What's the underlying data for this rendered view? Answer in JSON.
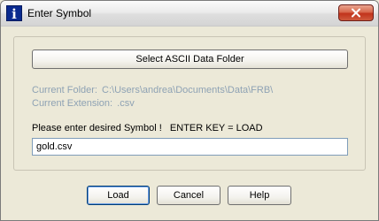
{
  "window": {
    "title": "Enter Symbol",
    "icon_glyph": "i",
    "icon_name": "info-icon"
  },
  "dialog": {
    "select_folder_label": "Select ASCII Data Folder",
    "current_folder_label": "Current Folder:",
    "current_folder_value": "C:\\Users\\andrea\\Documents\\Data\\FRB\\",
    "current_extension_label": "Current Extension:",
    "current_extension_value": ".csv",
    "prompt": "Please enter desired Symbol !   ENTER KEY = LOAD",
    "symbol_value": "gold.csv"
  },
  "buttons": {
    "load": "Load",
    "cancel": "Cancel",
    "help": "Help"
  },
  "colors": {
    "window_bg": "#ece9d8",
    "info_text": "#8ea2b4",
    "close_button": "#c1331b"
  }
}
